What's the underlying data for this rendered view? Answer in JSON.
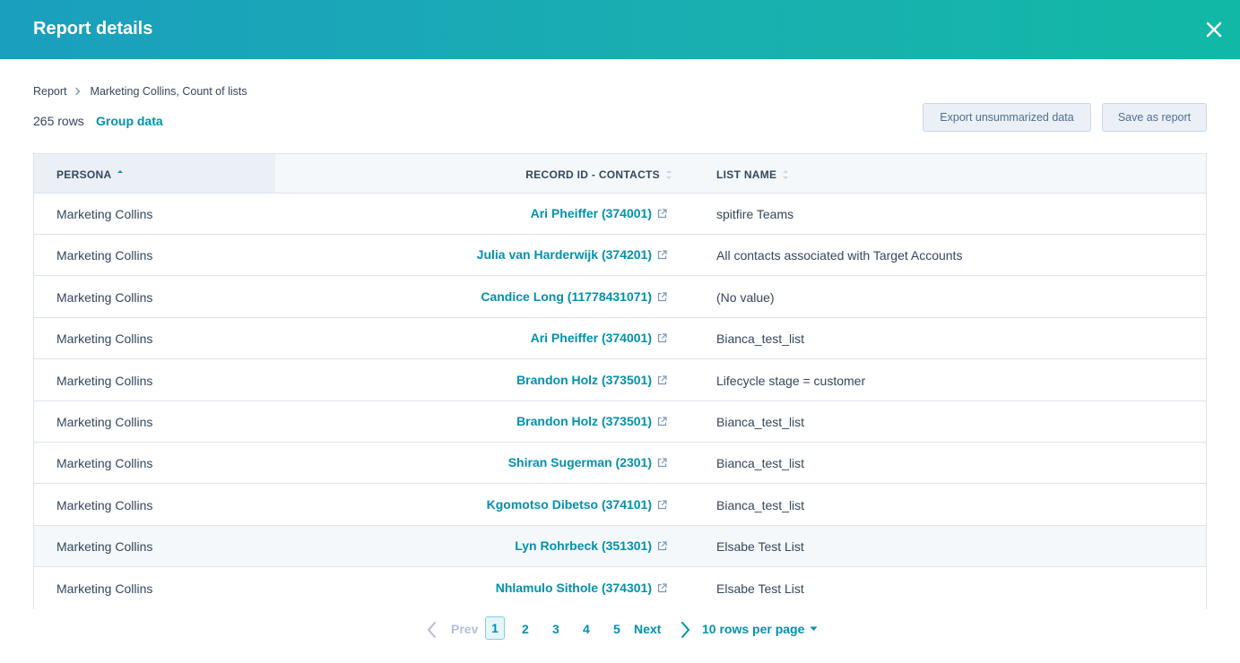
{
  "header": {
    "title": "Report details"
  },
  "breadcrumb": {
    "root": "Report",
    "current": "Marketing Collins, Count of lists"
  },
  "summary": {
    "row_count": "265 rows",
    "group_link": "Group data"
  },
  "actions": {
    "export_label": "Export unsummarized data",
    "save_label": "Save as report"
  },
  "table": {
    "columns": [
      "PERSONA",
      "RECORD ID - CONTACTS",
      "LIST NAME"
    ],
    "rows": [
      {
        "persona": "Marketing Collins",
        "record": "Ari Pheiffer (374001)",
        "list": "spitfire Teams"
      },
      {
        "persona": "Marketing Collins",
        "record": "Julia van Harderwijk (374201)",
        "list": "All contacts associated with Target Accounts"
      },
      {
        "persona": "Marketing Collins",
        "record": "Candice Long (11778431071)",
        "list": "(No value)"
      },
      {
        "persona": "Marketing Collins",
        "record": "Ari Pheiffer (374001)",
        "list": "Bianca_test_list"
      },
      {
        "persona": "Marketing Collins",
        "record": "Brandon Holz (373501)",
        "list": "Lifecycle stage = customer"
      },
      {
        "persona": "Marketing Collins",
        "record": "Brandon Holz (373501)",
        "list": "Bianca_test_list"
      },
      {
        "persona": "Marketing Collins",
        "record": "Shiran Sugerman (2301)",
        "list": "Bianca_test_list"
      },
      {
        "persona": "Marketing Collins",
        "record": "Kgomotso Dibetso (374101)",
        "list": "Bianca_test_list"
      },
      {
        "persona": "Marketing Collins",
        "record": "Lyn Rohrbeck (351301)",
        "list": "Elsabe Test List"
      },
      {
        "persona": "Marketing Collins",
        "record": "Nhlamulo Sithole (374301)",
        "list": "Elsabe Test List"
      }
    ]
  },
  "pagination": {
    "prev": "Prev",
    "pages": [
      "1",
      "2",
      "3",
      "4",
      "5"
    ],
    "current_page": "1",
    "next": "Next",
    "rows_per_page": "10 rows per page"
  },
  "colors": {
    "accent": "#0091ae",
    "header_start": "#1a9fbe",
    "header_end": "#12b8a6",
    "text": "#33475b"
  },
  "icons": [
    "close-icon",
    "chevron-right-icon",
    "sort-icon",
    "external-link-icon",
    "chevron-left-icon",
    "caret-down-icon"
  ]
}
